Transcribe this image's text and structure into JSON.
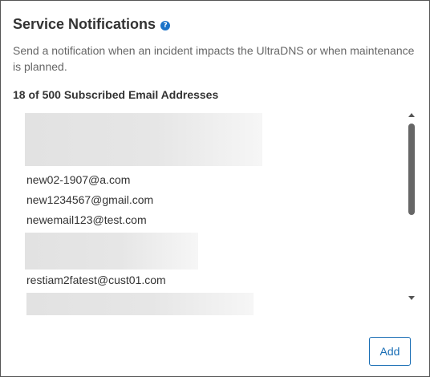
{
  "panel": {
    "title": "Service Notifications",
    "help_icon": "?",
    "description": "Send a notification when an incident impacts the UltraDNS or when maintenance is planned.",
    "count_label": "18 of 500 Subscribed Email Addresses"
  },
  "email_list": {
    "items": [
      {
        "type": "redacted"
      },
      {
        "type": "email",
        "value": "new02-1907@a.com"
      },
      {
        "type": "email",
        "value": "new1234567@gmail.com"
      },
      {
        "type": "email",
        "value": "newemail123@test.com"
      },
      {
        "type": "redacted"
      },
      {
        "type": "email",
        "value": "restiam2fatest@cust01.com"
      },
      {
        "type": "redacted"
      }
    ]
  },
  "actions": {
    "add_label": "Add"
  },
  "colors": {
    "accent": "#1a6eb5",
    "border": "#555555"
  },
  "icons": {
    "help": "question-circle-icon",
    "scroll_up": "scroll-up-arrow-icon",
    "scroll_down": "scroll-down-arrow-icon"
  }
}
